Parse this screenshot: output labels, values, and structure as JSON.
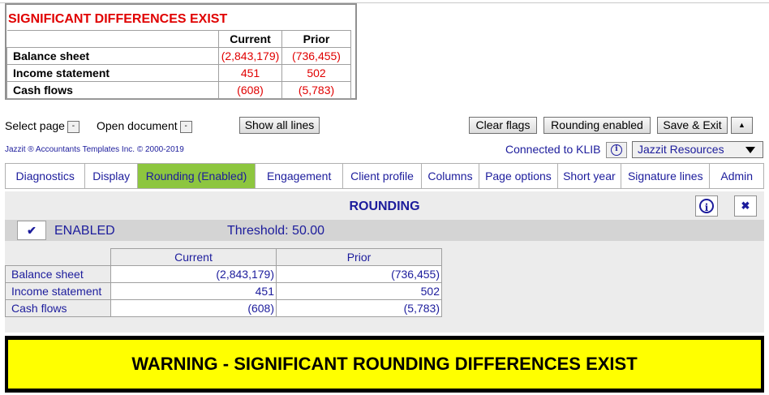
{
  "summary": {
    "title": "SIGNIFICANT DIFFERENCES EXIST",
    "col_current": "Current",
    "col_prior": "Prior",
    "rows": [
      {
        "label": "Balance sheet",
        "current": "(2,843,179)",
        "prior": "(736,455)"
      },
      {
        "label": "Income statement",
        "current": "451",
        "prior": "502"
      },
      {
        "label": "Cash flows",
        "current": "(608)",
        "prior": "(5,783)"
      }
    ]
  },
  "controls": {
    "select_page": "Select page",
    "open_document": "Open document",
    "minus": "-",
    "show_all_lines": "Show all lines",
    "clear_flags": "Clear flags",
    "rounding_enabled": "Rounding enabled",
    "save_exit": "Save & Exit",
    "caret_up": "▲",
    "copyright": "Jazzit ® Accountants Templates Inc. © 2000-2019",
    "connected": "Connected to KLIB",
    "info_glyph": "i",
    "resources": "Jazzit Resources"
  },
  "tabs": [
    {
      "label": "Diagnostics"
    },
    {
      "label": "Display"
    },
    {
      "label": "Rounding (Enabled)"
    },
    {
      "label": "Engagement"
    },
    {
      "label": "Client profile"
    },
    {
      "label": "Columns"
    },
    {
      "label": "Page options"
    },
    {
      "label": "Short year"
    },
    {
      "label": "Signature lines"
    },
    {
      "label": "Admin"
    }
  ],
  "rounding": {
    "title": "ROUNDING",
    "info_glyph": "i",
    "close_glyph": "✖",
    "check_glyph": "✔",
    "enabled": "ENABLED",
    "threshold": "Threshold: 50.00",
    "col_current": "Current",
    "col_prior": "Prior",
    "rows": [
      {
        "label": "Balance sheet",
        "current": "(2,843,179)",
        "prior": "(736,455)"
      },
      {
        "label": "Income statement",
        "current": "451",
        "prior": "502"
      },
      {
        "label": "Cash flows",
        "current": "(608)",
        "prior": "(5,783)"
      }
    ],
    "warning": "WARNING - SIGNIFICANT ROUNDING DIFFERENCES EXIST"
  },
  "colors": {
    "red": "#e00000",
    "blue": "#1c1c9c",
    "active_tab": "#8dc63f",
    "warning_bg": "#ffff00"
  }
}
